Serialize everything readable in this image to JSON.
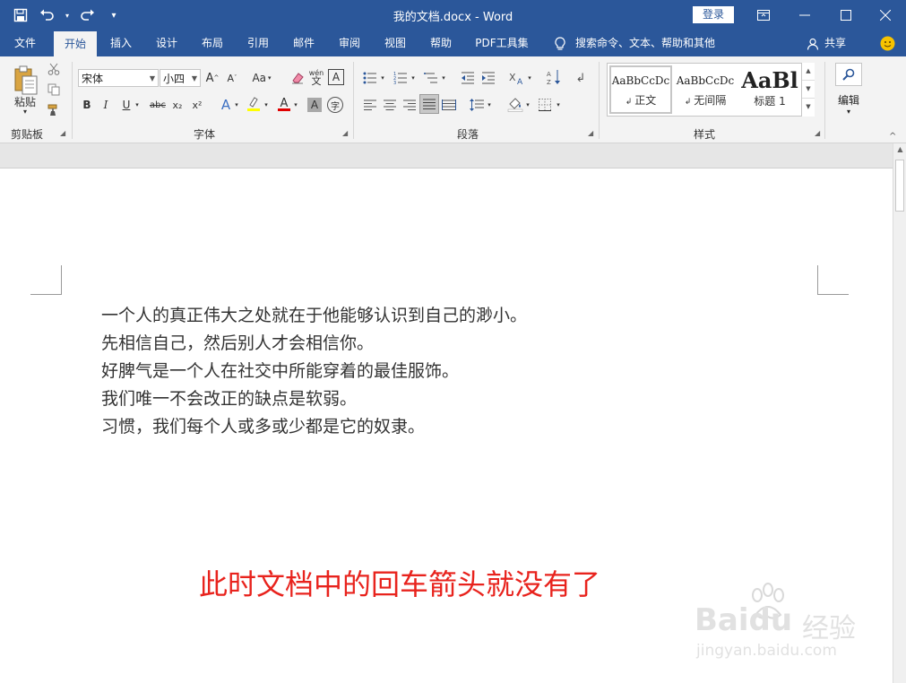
{
  "window": {
    "title": "我的文档.docx  -  Word",
    "login_label": "登录"
  },
  "menu": {
    "tabs": [
      "文件",
      "开始",
      "插入",
      "设计",
      "布局",
      "引用",
      "邮件",
      "审阅",
      "视图",
      "帮助",
      "PDF工具集"
    ],
    "active_tab": "开始",
    "search_hint": "搜索命令、文本、帮助和其他",
    "share_label": "共享"
  },
  "ribbon": {
    "clipboard": {
      "paste_label": "粘贴",
      "group_label": "剪贴板"
    },
    "font": {
      "font_name": "宋体",
      "font_size": "小四",
      "group_label": "字体",
      "grow_label": "A",
      "shrink_label": "A",
      "case_label": "Aa",
      "phonetic_label": "wén",
      "bold_label": "B",
      "italic_label": "I",
      "underline_label": "U",
      "strike_label": "abc",
      "subscript_label": "x₂",
      "superscript_label": "x²",
      "highlight_color": "#ffff00",
      "font_color": "#e00000"
    },
    "paragraph": {
      "group_label": "段落"
    },
    "styles": {
      "group_label": "样式",
      "items": [
        {
          "sample": "AaBbCcDc",
          "name": "正文"
        },
        {
          "sample": "AaBbCcDc",
          "name": "无间隔"
        },
        {
          "sample": "AaBl",
          "name": "标题 1"
        }
      ]
    },
    "editing": {
      "label": "编辑"
    }
  },
  "document": {
    "lines": [
      "一个人的真正伟大之处就在于他能够认识到自己的渺小。",
      "先相信自己，然后别人才会相信你。",
      "好脾气是一个人在社交中所能穿着的最佳服饰。",
      "我们唯一不会改正的缺点是软弱。",
      "习惯，我们每个人或多或少都是它的奴隶。"
    ]
  },
  "annotation": {
    "text": "此时文档中的回车箭头就没有了",
    "color": "#e8231d"
  },
  "watermark": {
    "brand": "Baidu",
    "brand_cn": "经验",
    "url": "jingyan.baidu.com"
  },
  "theme": {
    "titlebar": "#2b579a",
    "ribbon": "#f3f3f3"
  }
}
